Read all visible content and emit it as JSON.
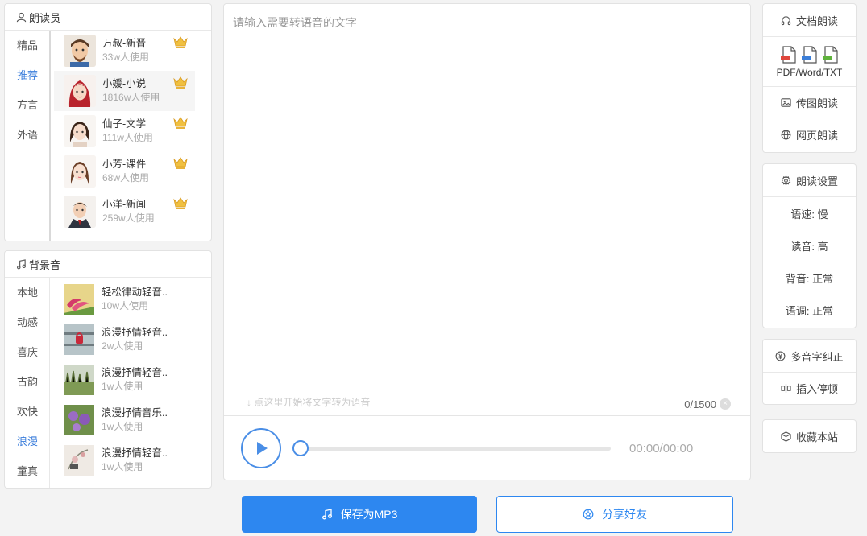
{
  "readers_panel": {
    "title": "朗读员",
    "categories": [
      "精品",
      "推荐",
      "方言",
      "外语"
    ],
    "active_category": "推荐",
    "items": [
      {
        "name": "万叔-新晋",
        "usage": "33w人使用"
      },
      {
        "name": "小媛-小说",
        "usage": "1816w人使用"
      },
      {
        "name": "仙子-文学",
        "usage": "111w人使用"
      },
      {
        "name": "小芳-课件",
        "usage": "68w人使用"
      },
      {
        "name": "小洋-新闻",
        "usage": "259w人使用"
      }
    ]
  },
  "bgm_panel": {
    "title": "背景音",
    "categories": [
      "本地",
      "动感",
      "喜庆",
      "古韵",
      "欢快",
      "浪漫",
      "童真"
    ],
    "active_category": "浪漫",
    "items": [
      {
        "name": "轻松律动轻音..",
        "usage": "10w人使用"
      },
      {
        "name": "浪漫抒情轻音..",
        "usage": "2w人使用"
      },
      {
        "name": "浪漫抒情轻音..",
        "usage": "1w人使用"
      },
      {
        "name": "浪漫抒情音乐..",
        "usage": "1w人使用"
      },
      {
        "name": "浪漫抒情轻音..",
        "usage": "1w人使用"
      }
    ]
  },
  "editor": {
    "placeholder": "请输入需要转语音的文字",
    "hint": "点这里开始将文字转为语音",
    "counter": "0/1500",
    "clear": "×"
  },
  "player": {
    "time": "00:00/00:00",
    "progress": 0
  },
  "actions": {
    "save_label": "保存为MP3",
    "share_label": "分享好友"
  },
  "right_panel": {
    "doc_read": "文档朗读",
    "doc_types": "PDF/Word/TXT",
    "image_read": "传图朗读",
    "web_read": "网页朗读",
    "settings_title": "朗读设置",
    "speed": "语速: 慢",
    "volume": "读音: 高",
    "bg_volume": "背音: 正常",
    "tone": "语调: 正常",
    "polyphone": "多音字纠正",
    "pause": "插入停顿",
    "bookmark": "收藏本站"
  },
  "colors": {
    "accent": "#2d87f0",
    "active_text": "#3a7ddb",
    "crown": "#e8b33a"
  }
}
